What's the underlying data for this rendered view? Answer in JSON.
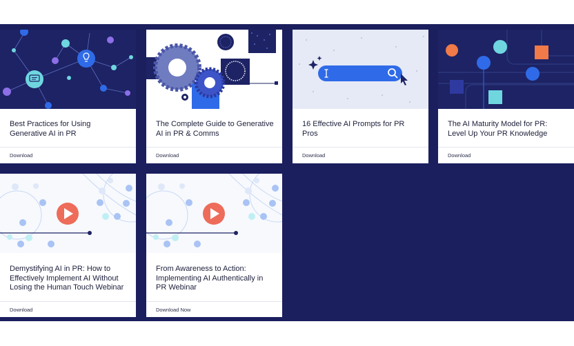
{
  "cards": [
    {
      "title": "Best Practices for Using Generative AI in PR",
      "link": "Download"
    },
    {
      "title": "The Complete Guide to Generative AI in PR & Comms",
      "link": "Download"
    },
    {
      "title": "16 Effective AI Prompts for PR Pros",
      "link": "Download"
    },
    {
      "title": "The AI Maturity Model for PR: Level Up Your PR Knowledge",
      "link": "Download"
    },
    {
      "title": "Demystifying AI in PR: How to Effectively Implement AI Without Losing the Human Touch Webinar",
      "link": "Download"
    },
    {
      "title": "From Awareness to Action: Implementing AI Authentically in PR Webinar",
      "link": "Download Now"
    }
  ],
  "colors": {
    "band": "#1b1f5e",
    "accent_blue": "#2f6be8",
    "accent_cyan": "#6fd6e0",
    "accent_orange": "#f07a48",
    "play_red": "#ee6c5a"
  },
  "icons": [
    "chat-bubble-icon",
    "lightbulb-icon",
    "gear-icon",
    "search-icon",
    "sparkle-icon",
    "text-cursor-icon",
    "mouse-pointer-icon",
    "play-icon"
  ]
}
